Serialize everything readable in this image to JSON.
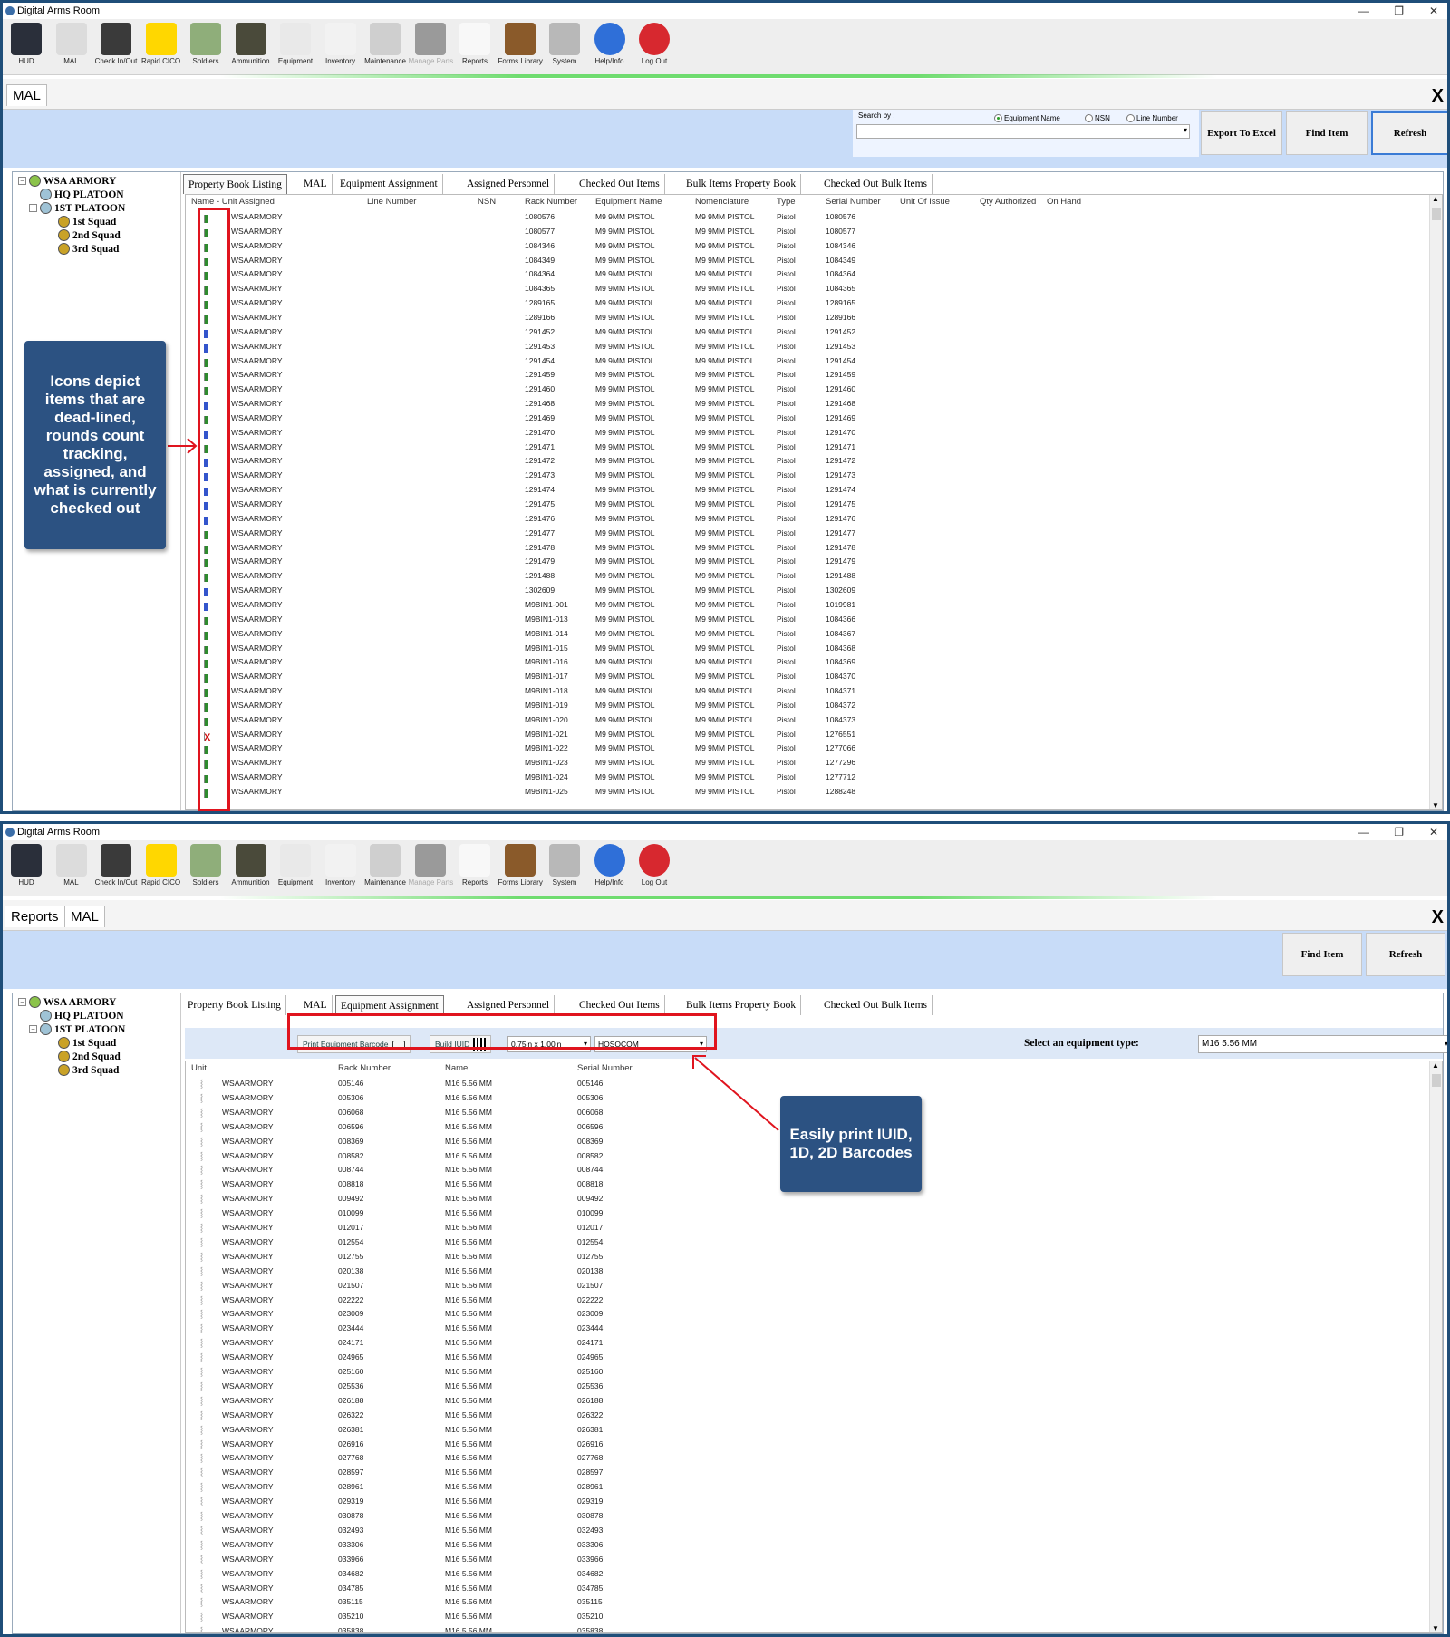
{
  "screen1": {
    "window_title": "Digital Arms Room",
    "toolbar": [
      {
        "label": "HUD",
        "icon": "hud-icon",
        "enabled": true
      },
      {
        "label": "MAL",
        "icon": "mal-clipboard-icon",
        "enabled": true
      },
      {
        "label": "Check In/Out",
        "icon": "handheld-scanner-icon",
        "enabled": true
      },
      {
        "label": "Rapid CICO",
        "icon": "lightning-icon",
        "enabled": true
      },
      {
        "label": "Soldiers",
        "icon": "soldier-icon",
        "enabled": true
      },
      {
        "label": "Ammunition",
        "icon": "ammo-box-icon",
        "enabled": true
      },
      {
        "label": "Equipment",
        "icon": "rifle-icon",
        "enabled": true
      },
      {
        "label": "Inventory",
        "icon": "inventory-icon",
        "enabled": true
      },
      {
        "label": "Maintenance",
        "icon": "tools-icon",
        "enabled": true
      },
      {
        "label": "Manage Parts",
        "icon": "parts-icon",
        "enabled": false
      },
      {
        "label": "Reports",
        "icon": "report-chart-icon",
        "enabled": true
      },
      {
        "label": "Forms Library",
        "icon": "book-icon",
        "enabled": true
      },
      {
        "label": "System",
        "icon": "gear-icon",
        "enabled": true
      },
      {
        "label": "Help/Info",
        "icon": "info-icon",
        "enabled": true
      },
      {
        "label": "Log Out",
        "icon": "logout-x-icon",
        "enabled": true
      }
    ],
    "doc_tabs": [
      "MAL"
    ],
    "close_label": "X",
    "search": {
      "label": "Search by :",
      "options": [
        "Equipment Name",
        "NSN",
        "Line Number"
      ],
      "selected": "Equipment Name",
      "value": ""
    },
    "buttons": {
      "export": "Export To Excel",
      "find": "Find Item",
      "refresh": "Refresh"
    },
    "tree": {
      "root": "WSA ARMORY",
      "children": [
        "HQ PLATOON",
        "1ST PLATOON",
        "1st Squad",
        "2nd Squad",
        "3rd Squad"
      ]
    },
    "grid_tabs": [
      "Property Book Listing",
      "MAL",
      "Equipment Assignment",
      "Assigned Personnel",
      "Checked Out Items",
      "Bulk Items Property Book",
      "Checked Out Bulk Items"
    ],
    "selected_tab": "Property Book Listing",
    "columns": [
      "Name - Unit Assigned",
      "Line Number",
      "NSN",
      "Rack Number",
      "Equipment Name",
      "Nomenclature",
      "Type",
      "Serial Number",
      "Unit Of Issue",
      "Qty Authorized",
      "On Hand"
    ],
    "unit": "WSAARMORY",
    "equipment_name": "M9 9MM PISTOL",
    "nomenclature": "M9 9MM PISTOL",
    "type": "Pistol",
    "rows": [
      {
        "rack": "1080576",
        "serial": "1080576",
        "flags": ""
      },
      {
        "rack": "1080577",
        "serial": "1080577",
        "flags": ""
      },
      {
        "rack": "1084346",
        "serial": "1084346",
        "flags": ""
      },
      {
        "rack": "1084349",
        "serial": "1084349",
        "flags": ""
      },
      {
        "rack": "1084364",
        "serial": "1084364",
        "flags": ""
      },
      {
        "rack": "1084365",
        "serial": "1084365",
        "flags": ""
      },
      {
        "rack": "1289165",
        "serial": "1289165",
        "flags": ""
      },
      {
        "rack": "1289166",
        "serial": "1289166",
        "flags": ""
      },
      {
        "rack": "1291452",
        "serial": "1291452",
        "flags": "a"
      },
      {
        "rack": "1291453",
        "serial": "1291453",
        "flags": "a"
      },
      {
        "rack": "1291454",
        "serial": "1291454",
        "flags": ""
      },
      {
        "rack": "1291459",
        "serial": "1291459",
        "flags": ""
      },
      {
        "rack": "1291460",
        "serial": "1291460",
        "flags": ""
      },
      {
        "rack": "1291468",
        "serial": "1291468",
        "flags": "a"
      },
      {
        "rack": "1291469",
        "serial": "1291469",
        "flags": ""
      },
      {
        "rack": "1291470",
        "serial": "1291470",
        "flags": "a"
      },
      {
        "rack": "1291471",
        "serial": "1291471",
        "flags": ""
      },
      {
        "rack": "1291472",
        "serial": "1291472",
        "flags": "a"
      },
      {
        "rack": "1291473",
        "serial": "1291473",
        "flags": "a"
      },
      {
        "rack": "1291474",
        "serial": "1291474",
        "flags": "a"
      },
      {
        "rack": "1291475",
        "serial": "1291475",
        "flags": "a"
      },
      {
        "rack": "1291476",
        "serial": "1291476",
        "flags": "a"
      },
      {
        "rack": "1291477",
        "serial": "1291477",
        "flags": ""
      },
      {
        "rack": "1291478",
        "serial": "1291478",
        "flags": ""
      },
      {
        "rack": "1291479",
        "serial": "1291479",
        "flags": ""
      },
      {
        "rack": "1291488",
        "serial": "1291488",
        "flags": ""
      },
      {
        "rack": "1302609",
        "serial": "1302609",
        "flags": "a"
      },
      {
        "rack": "M9BIN1-001",
        "serial": "1019981",
        "flags": "a"
      },
      {
        "rack": "M9BIN1-013",
        "serial": "1084366",
        "flags": ""
      },
      {
        "rack": "M9BIN1-014",
        "serial": "1084367",
        "flags": ""
      },
      {
        "rack": "M9BIN1-015",
        "serial": "1084368",
        "flags": ""
      },
      {
        "rack": "M9BIN1-016",
        "serial": "1084369",
        "flags": ""
      },
      {
        "rack": "M9BIN1-017",
        "serial": "1084370",
        "flags": ""
      },
      {
        "rack": "M9BIN1-018",
        "serial": "1084371",
        "flags": ""
      },
      {
        "rack": "M9BIN1-019",
        "serial": "1084372",
        "flags": ""
      },
      {
        "rack": "M9BIN1-020",
        "serial": "1084373",
        "flags": ""
      },
      {
        "rack": "M9BIN1-021",
        "serial": "1276551",
        "flags": "x"
      },
      {
        "rack": "M9BIN1-022",
        "serial": "1277066",
        "flags": ""
      },
      {
        "rack": "M9BIN1-023",
        "serial": "1277296",
        "flags": ""
      },
      {
        "rack": "M9BIN1-024",
        "serial": "1277712",
        "flags": ""
      },
      {
        "rack": "M9BIN1-025",
        "serial": "1288248",
        "flags": ""
      }
    ],
    "callout": "Icons depict items that are dead-lined, rounds count tracking, assigned, and what is currently checked out"
  },
  "screen2": {
    "window_title": "Digital Arms Room",
    "doc_tabs": [
      "Reports",
      "MAL"
    ],
    "close_label": "X",
    "buttons": {
      "find": "Find Item",
      "refresh": "Refresh"
    },
    "selected_tab": "Equipment Assignment",
    "print_button": "Print Equipment Barcode",
    "iuid_button": "Build IUID",
    "label_size": "0.75in x 1.00in",
    "unit_select": "HQSOCOM",
    "equip_type_label": "Select an equipment type:",
    "equip_type_value": "M16 5.56 MM",
    "columns": [
      "Unit",
      "Rack Number",
      "Name",
      "Serial Number"
    ],
    "unit": "WSAARMORY",
    "name": "M16 5.56 MM",
    "serials": [
      "005146",
      "005306",
      "006068",
      "006596",
      "008369",
      "008582",
      "008744",
      "008818",
      "009492",
      "010099",
      "012017",
      "012554",
      "012755",
      "020138",
      "021507",
      "022222",
      "023009",
      "023444",
      "024171",
      "024965",
      "025160",
      "025536",
      "026188",
      "026322",
      "026381",
      "026916",
      "027768",
      "028597",
      "028961",
      "029319",
      "030878",
      "032493",
      "033306",
      "033966",
      "034682",
      "034785",
      "035115",
      "035210",
      "035838"
    ],
    "callout": "Easily print IUID, 1D, 2D Barcodes"
  },
  "colors": {
    "accent_band": "#c8dcf8",
    "callout": "#2c5282",
    "highlight": "#e0141e",
    "frame": "#1f4e79"
  }
}
